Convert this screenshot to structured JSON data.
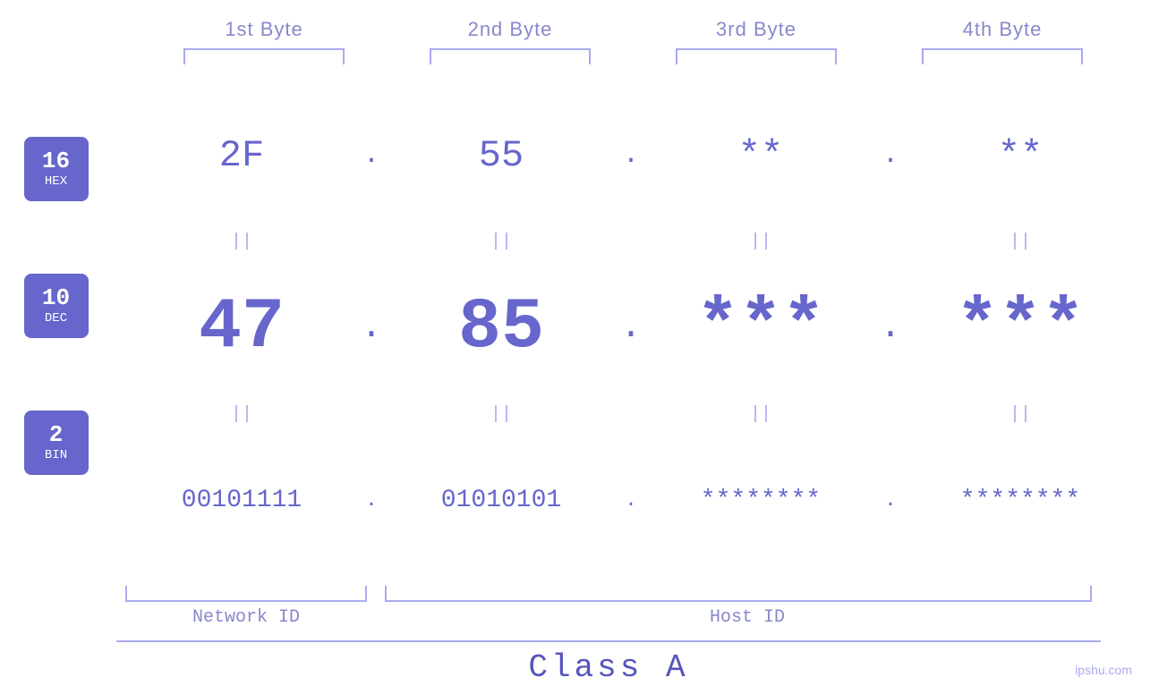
{
  "header": {
    "byte1": "1st Byte",
    "byte2": "2nd Byte",
    "byte3": "3rd Byte",
    "byte4": "4th Byte"
  },
  "badges": [
    {
      "number": "16",
      "label": "HEX"
    },
    {
      "number": "10",
      "label": "DEC"
    },
    {
      "number": "2",
      "label": "BIN"
    }
  ],
  "hex_row": {
    "b1": "2F",
    "b2": "55",
    "b3": "**",
    "b4": "**",
    "dot": "."
  },
  "dec_row": {
    "b1": "47",
    "b2": "85",
    "b3": "***",
    "b4": "***",
    "dot": "."
  },
  "bin_row": {
    "b1": "00101111",
    "b2": "01010101",
    "b3": "********",
    "b4": "********",
    "dot": "."
  },
  "separator": "||",
  "labels": {
    "network_id": "Network ID",
    "host_id": "Host ID",
    "class": "Class A"
  },
  "watermark": "ipshu.com"
}
